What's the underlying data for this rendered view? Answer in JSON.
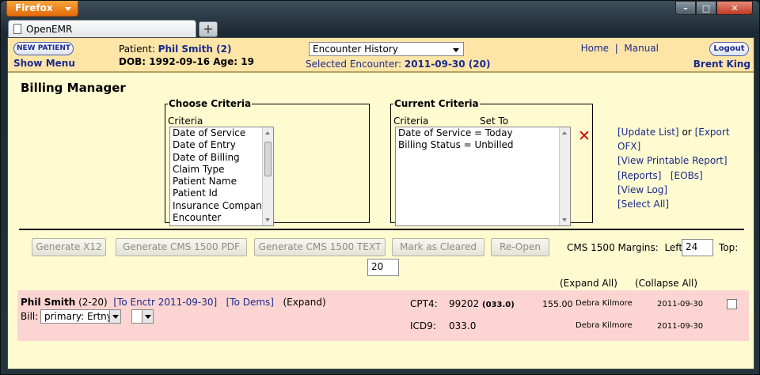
{
  "browser": {
    "menu_label": "Firefox",
    "tab_title": "OpenEMR",
    "new_tab": "+",
    "min": "–",
    "max": "□",
    "close": "✕"
  },
  "header": {
    "new_patient": "NEW PATIENT",
    "show_menu": "Show Menu",
    "patient_label": "Patient:",
    "patient_name": "Phil Smith (2)",
    "dob_label": "DOB: 1992-09-16 Age: 19",
    "encounter_select": "Encounter History",
    "selected_label": "Selected Encounter:",
    "selected_value": "2011-09-30 (20)",
    "home": "Home",
    "sep": "|",
    "manual": "Manual",
    "logout": "Logout",
    "user": "Brent King"
  },
  "page": {
    "title": "Billing Manager"
  },
  "choose": {
    "legend": "Choose Criteria",
    "col": "Criteria",
    "items": [
      "Date of Service",
      "Date of Entry",
      "Date of Billing",
      "Claim Type",
      "Patient Name",
      "Patient Id",
      "Insurance Company",
      "Encounter"
    ]
  },
  "current": {
    "legend": "Current Criteria",
    "col1": "Criteria",
    "col2": "Set To",
    "items": [
      "Date of Service = Today",
      "Billing Status = Unbilled"
    ]
  },
  "actions": {
    "update_list": "[Update List]",
    "or": "or",
    "export_ofx": "[Export OFX]",
    "printable": "[View Printable Report]",
    "reports": "[Reports]",
    "eobs": "[EOBs]",
    "view_log": "[View Log]",
    "select_all": "[Select All]"
  },
  "buttons": {
    "x12": "Generate X12",
    "cms_pdf": "Generate CMS 1500 PDF",
    "cms_text": "Generate CMS 1500 TEXT",
    "mark_cleared": "Mark as Cleared",
    "reopen": "Re-Open"
  },
  "margins": {
    "label": "CMS 1500 Margins:",
    "left_label": "Left:",
    "left_value": "24",
    "top_label": "Top:",
    "top_value": "20"
  },
  "expand_all": "(Expand All)",
  "collapse_all": "(Collapse All)",
  "encounter": {
    "patient": "Phil Smith",
    "pid": "(2-20)",
    "to_enctr": "[To Enctr 2011-09-30]",
    "to_dems": "[To Dems]",
    "expand": "(Expand)",
    "bill_label": "Bill:",
    "bill_value": "primary: Ertny",
    "lines": [
      {
        "type": "CPT4:",
        "code": "99202",
        "mod": "(033.0)",
        "amount": "155.00",
        "provider": "Debra Kilmore",
        "date": "2011-09-30"
      },
      {
        "type": "ICD9:",
        "code": "033.0",
        "mod": "",
        "amount": "",
        "provider": "Debra Kilmore",
        "date": "2011-09-30"
      }
    ]
  }
}
